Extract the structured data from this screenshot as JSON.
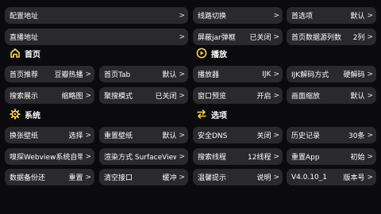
{
  "colors": {
    "background": "#0b0b0d",
    "tile": "#2a2a2e",
    "accent": "#f4a9ff",
    "section_icon": "#ffd84a"
  },
  "rows": {
    "r1": [
      {
        "label": "配置地址",
        "value": ""
      },
      {
        "label": "线路切换",
        "value": ""
      },
      {
        "label": "首选项",
        "value": "默认"
      }
    ],
    "r2": [
      {
        "label": "直播地址",
        "value": ""
      },
      {
        "label": "屏蔽jar弹框",
        "value": "已关闭"
      },
      {
        "label": "首页数据源列数",
        "value": "2列"
      }
    ]
  },
  "sections": {
    "home": {
      "title": "首页",
      "icon": "home-icon"
    },
    "play": {
      "title": "播放",
      "icon": "play-icon"
    },
    "system": {
      "title": "系统",
      "icon": "gear-icon"
    },
    "options": {
      "title": "选项",
      "icon": "swap-icon"
    }
  },
  "home_tiles": [
    [
      {
        "label": "首页推荐",
        "value": "豆瓣热播"
      },
      {
        "label": "首页Tab",
        "value": "默认"
      }
    ],
    [
      {
        "label": "搜索展示",
        "value": "缩略图"
      },
      {
        "label": "聚搜模式",
        "value": "已关闭"
      }
    ]
  ],
  "play_tiles": [
    [
      {
        "label": "播放器",
        "value": "IJK"
      },
      {
        "label": "IJK解码方式",
        "value": "硬解码"
      }
    ],
    [
      {
        "label": "窗口预览",
        "value": "开启"
      },
      {
        "label": "画面缩放",
        "value": "默认"
      }
    ]
  ],
  "system_tiles": [
    [
      {
        "label": "换张壁纸",
        "value": "选择"
      },
      {
        "label": "重置壁纸",
        "value": "默认"
      }
    ],
    [
      {
        "label": "嗅探Webview系统自带",
        "value": ""
      },
      {
        "label": "渲染方式 SurfaceView",
        "value": ""
      }
    ],
    [
      {
        "label": "数据备份还",
        "value": "重置"
      },
      {
        "label": "清空接口",
        "value": "缓冲"
      }
    ]
  ],
  "options_tiles": [
    [
      {
        "label": "安全DNS",
        "value": "关闭"
      },
      {
        "label": "历史记录",
        "value": "30条"
      }
    ],
    [
      {
        "label": "搜索线程",
        "value": "12线程"
      },
      {
        "label": "重置App",
        "value": "初始"
      }
    ],
    [
      {
        "label": "温馨提示",
        "value": "说明"
      },
      {
        "label": "V4.0.10_1",
        "value": "版本号"
      }
    ]
  ]
}
